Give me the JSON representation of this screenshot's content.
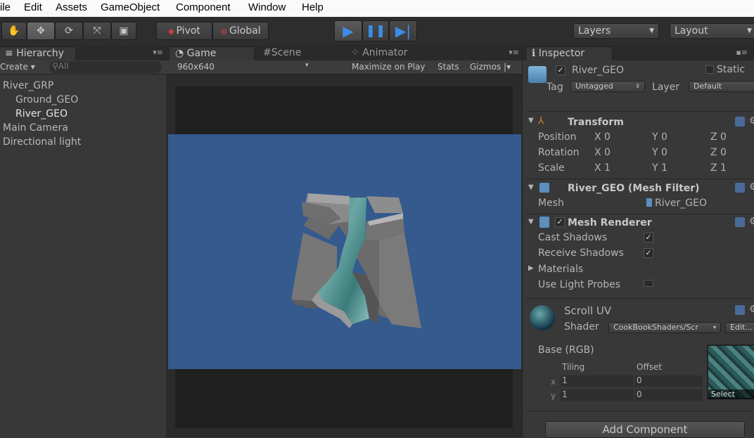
{
  "menu": [
    "ile",
    "Edit",
    "Assets",
    "GameObject",
    "Component",
    "Window",
    "Help"
  ],
  "toolbar": {
    "pivot": "Pivot",
    "global": "Global",
    "layers": "Layers",
    "layout": "Layout",
    "play_icon": "play-icon",
    "pause_icon": "pause-icon",
    "step_icon": "step-icon"
  },
  "hierarchy": {
    "tab": "Hierarchy",
    "create": "Create",
    "search": "All",
    "items": [
      "River_GRP",
      "Ground_GEO",
      "River_GEO",
      "Main Camera",
      "Directional light"
    ]
  },
  "game": {
    "tab_game": "Game",
    "tab_scene": "Scene",
    "tab_animator": "Animator",
    "resolution": "960x640",
    "maximize": "Maximize on Play",
    "stats": "Stats",
    "gizmos": "Gizmos",
    "viewport_color": "#345a8e"
  },
  "inspector": {
    "tab": "Inspector",
    "object_name": "River_GEO",
    "static": "Static",
    "tag_label": "Tag",
    "tag_value": "Untagged",
    "layer_label": "Layer",
    "layer_value": "Default",
    "transform": {
      "title": "Transform",
      "position_label": "Position",
      "rotation_label": "Rotation",
      "scale_label": "Scale",
      "axis_x": "X",
      "axis_y": "Y",
      "axis_z": "Z",
      "position": [
        "0",
        "0",
        "0"
      ],
      "rotation": [
        "0",
        "0",
        "0"
      ],
      "scale": [
        "1",
        "1",
        "1"
      ]
    },
    "mesh_filter": {
      "title": "River_GEO (Mesh Filter)",
      "mesh_label": "Mesh",
      "mesh_value": "River_GEO"
    },
    "mesh_renderer": {
      "title": "Mesh Renderer",
      "cast_shadows": "Cast Shadows",
      "receive_shadows": "Receive Shadows",
      "materials": "Materials",
      "light_probes": "Use Light Probes"
    },
    "material": {
      "name": "Scroll UV",
      "shader_label": "Shader",
      "shader_value": "CookBookShaders/Scr",
      "edit": "Edit...",
      "base": "Base (RGB)",
      "tiling": "Tiling",
      "offset": "Offset",
      "row_x": "x",
      "row_y": "y",
      "tiling_x": "1",
      "tiling_y": "1",
      "offset_x": "0",
      "offset_y": "0",
      "select": "Select"
    },
    "add_component": "Add Component"
  }
}
